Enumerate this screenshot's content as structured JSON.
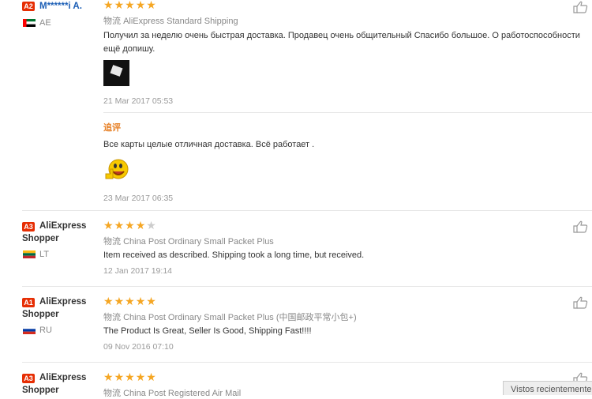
{
  "reviews": [
    {
      "level": "A2",
      "level_color": "#e62e04",
      "username": "M******i A.",
      "country": "AE",
      "rating": 5,
      "shipping_icon": "物流",
      "shipping": "AliExpress Standard Shipping",
      "text": "Получил за неделю очень быстрая доставка. Продавец очень общительный Спасибо большое. О работоспособности ещё допишу.",
      "date": "21 Mar 2017 05:53",
      "additional_label": "追评",
      "additional_text": "Все карты целые отличная доставка. Всё работает .",
      "additional_date": "23 Mar 2017 06:35"
    },
    {
      "level": "A3",
      "username_line1": "AliExpress",
      "username_line2": "Shopper",
      "country": "LT",
      "rating": 4,
      "shipping_icon": "物流",
      "shipping": "China Post Ordinary Small Packet Plus",
      "text": "Item received as described. Shipping took a long time, but received.",
      "date": "12 Jan 2017 19:14"
    },
    {
      "level": "A1",
      "username_line1": "AliExpress",
      "username_line2": "Shopper",
      "country": "RU",
      "rating": 5,
      "shipping_icon": "物流",
      "shipping": "China Post Ordinary Small Packet Plus (中国邮政平常小包+)",
      "text": "The Product Is Great, Seller Is Good, Shipping Fast!!!!",
      "date": "09 Nov 2016 07:10"
    },
    {
      "level": "A3",
      "username_line1": "AliExpress",
      "username_line2": "Shopper",
      "rating": 5,
      "shipping_icon": "物流",
      "shipping": "China Post Registered Air Mail"
    }
  ],
  "recently_viewed": "Vistos recientemente"
}
